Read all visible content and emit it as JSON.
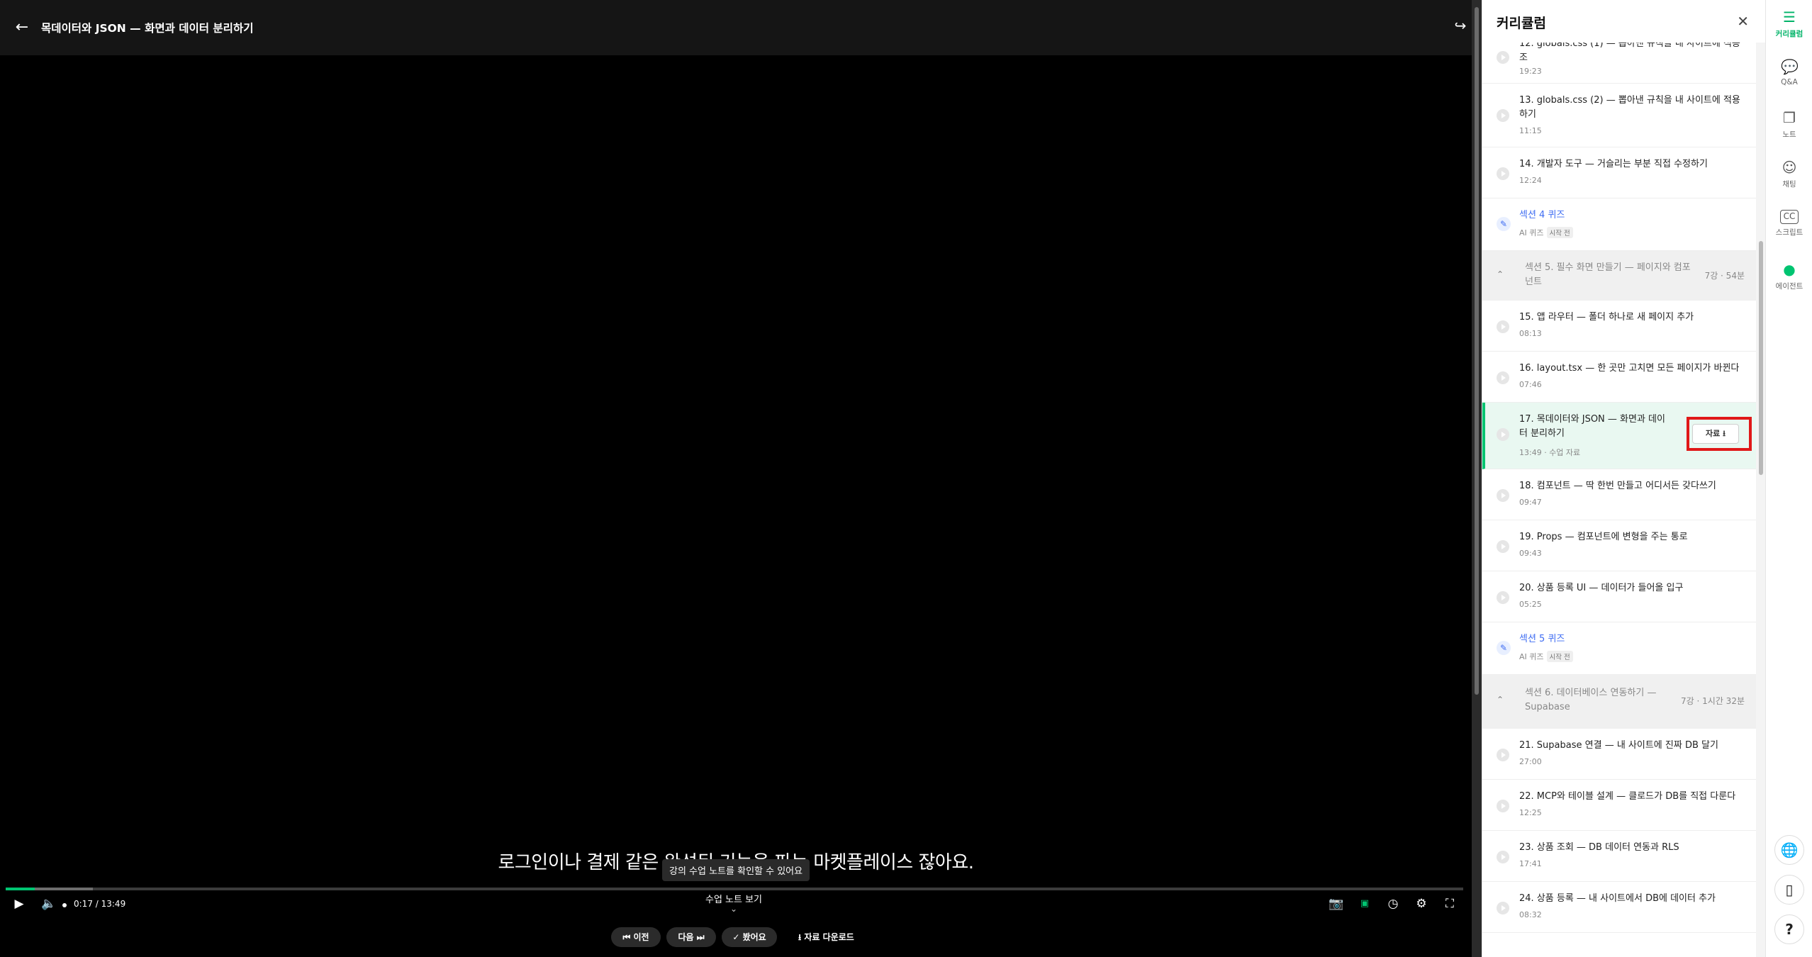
{
  "player": {
    "title": "목데이터와 JSON — 화면과 데이터 분리하기",
    "subtitle": "로그인이나 결제 같은 완성된 기능을 파는 마켓플레이스 잖아요.",
    "tooltip": "강의 수업 노트를 확인할 수 있어요",
    "time": "0:17 / 13:49",
    "progress_fraction": 0.02,
    "notes_toggle": "수업 노트 보기",
    "prev": "이전",
    "next": "다음",
    "done": "봤어요",
    "download": "자료 다운로드"
  },
  "panel": {
    "title": "커리큘럼",
    "lessons_a": [
      {
        "title": "12. globals.css (1) — 뽑아낸 규칙을 내 사이트에 적용 조",
        "meta": "19:23"
      },
      {
        "title": "13. globals.css (2) — 뽑아낸 규칙을 내 사이트에 적용하기",
        "meta": "11:15"
      },
      {
        "title": "14. 개발자 도구 — 거슬리는 부분 직접 수정하기",
        "meta": "12:24"
      }
    ],
    "quiz4": {
      "title": "섹션 4 퀴즈",
      "sub": "AI 퀴즈",
      "tag": "시작 전"
    },
    "section5": {
      "title": "섹션 5. 필수 화면 만들기 — 페이지와 컴포넌트",
      "meta": "7강 · 54분"
    },
    "lessons_b": [
      {
        "title": "15. 앱 라우터 — 폴더 하나로 새 페이지 추가",
        "meta": "08:13"
      },
      {
        "title": "16. layout.tsx — 한 곳만 고치면 모든 페이지가 바뀐다",
        "meta": "07:46"
      }
    ],
    "active": {
      "title": "17. 목데이터와 JSON — 화면과 데이터 분리하기",
      "meta": "13:49 · 수업 자료",
      "button": "자료 ⭳"
    },
    "lessons_c": [
      {
        "title": "18. 컴포넌트 — 딱 한번 만들고 어디서든 갖다쓰기",
        "meta": "09:47"
      },
      {
        "title": "19. Props — 컴포넌트에 변형을 주는 통로",
        "meta": "09:43"
      },
      {
        "title": "20. 상품 등록 UI — 데이터가 들어올 입구",
        "meta": "05:25"
      }
    ],
    "quiz5": {
      "title": "섹션 5 퀴즈",
      "sub": "AI 퀴즈",
      "tag": "시작 전"
    },
    "section6": {
      "title": "섹션 6. 데이터베이스 연동하기 — Supabase",
      "meta": "7강 · 1시간 32분"
    },
    "lessons_d": [
      {
        "title": "21. Supabase 연결 — 내 사이트에 진짜 DB 달기",
        "meta": "27:00"
      },
      {
        "title": "22. MCP와 테이블 설계 — 클로드가 DB를 직접 다룬다",
        "meta": "12:25"
      },
      {
        "title": "23. 상품 조회 — DB 데이터 연동과 RLS",
        "meta": "17:41"
      },
      {
        "title": "24. 상품 등록 — 내 사이트에서 DB에 데이터 추가",
        "meta": "08:32"
      }
    ]
  },
  "rail": {
    "items": [
      {
        "label": "커리큘럼"
      },
      {
        "label": "Q&A"
      },
      {
        "label": "노트"
      },
      {
        "label": "채팅"
      },
      {
        "label": "스크립트"
      },
      {
        "label": "에이전트"
      }
    ],
    "help": "?"
  },
  "colors": {
    "accent": "#00c471",
    "quiz": "#3e6cf2",
    "highlight": "#e01818"
  }
}
